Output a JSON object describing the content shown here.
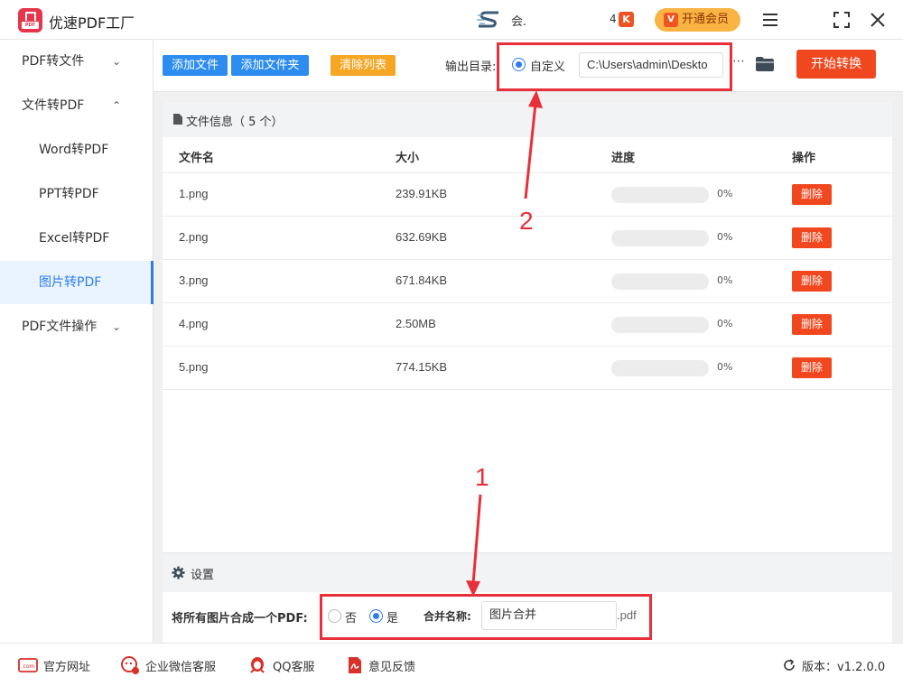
{
  "app": {
    "title": "优速PDF工厂",
    "logo_text": "PDF"
  },
  "titlebar": {
    "user_name": "会.",
    "count": "4",
    "vip_small_icon": "K",
    "vip_button_label": "开通会员",
    "vip_icon_letter": "V"
  },
  "sidebar": {
    "items": [
      {
        "label": "PDF转文件",
        "chevron": "⌄"
      },
      {
        "label": "文件转PDF",
        "chevron": "⌃"
      },
      {
        "label": "Word转PDF"
      },
      {
        "label": "PPT转PDF"
      },
      {
        "label": "Excel转PDF"
      },
      {
        "label": "图片转PDF"
      },
      {
        "label": "PDF文件操作",
        "chevron": "⌄"
      }
    ],
    "active_index": 5
  },
  "toolbar": {
    "add_file": "添加文件",
    "add_folder": "添加文件夹",
    "clear_list": "清除列表",
    "output_dir_label": "输出目录:",
    "custom_label": "自定义",
    "path_value": "C:\\Users\\admin\\Deskto",
    "more": "⋯",
    "start": "开始转换"
  },
  "file_panel": {
    "header": "文件信息（ 5 个）",
    "columns": {
      "name": "文件名",
      "size": "大小",
      "progress": "进度",
      "op": "操作"
    },
    "rows": [
      {
        "name": "1.png",
        "size": "239.91KB",
        "progress_pct": 0,
        "progress_text": "0%",
        "op": "删除"
      },
      {
        "name": "2.png",
        "size": "632.69KB",
        "progress_pct": 0,
        "progress_text": "0%",
        "op": "删除"
      },
      {
        "name": "3.png",
        "size": "671.84KB",
        "progress_pct": 0,
        "progress_text": "0%",
        "op": "删除"
      },
      {
        "name": "4.png",
        "size": "2.50MB",
        "progress_pct": 0,
        "progress_text": "0%",
        "op": "删除"
      },
      {
        "name": "5.png",
        "size": "774.15KB",
        "progress_pct": 0,
        "progress_text": "0%",
        "op": "删除"
      }
    ]
  },
  "settings": {
    "title": "设置",
    "merge_label": "将所有图片合成一个PDF:",
    "no_label": "否",
    "yes_label": "是",
    "selected": "yes",
    "name_label": "合并名称:",
    "name_value": "图片合并",
    "suffix": ".pdf"
  },
  "footer": {
    "website": "官方网址",
    "wechat": "企业微信客服",
    "qq": "QQ客服",
    "feedback": "意见反馈",
    "version": "版本：v1.2.0.0"
  },
  "annotations": {
    "label_1": "1",
    "label_2": "2"
  },
  "colors": {
    "primary_blue": "#2d8cf0",
    "danger_red": "#f0471e",
    "warning_orange": "#f5a623",
    "annotation_red": "#e8303a",
    "vip_gold": "#f9b443"
  }
}
